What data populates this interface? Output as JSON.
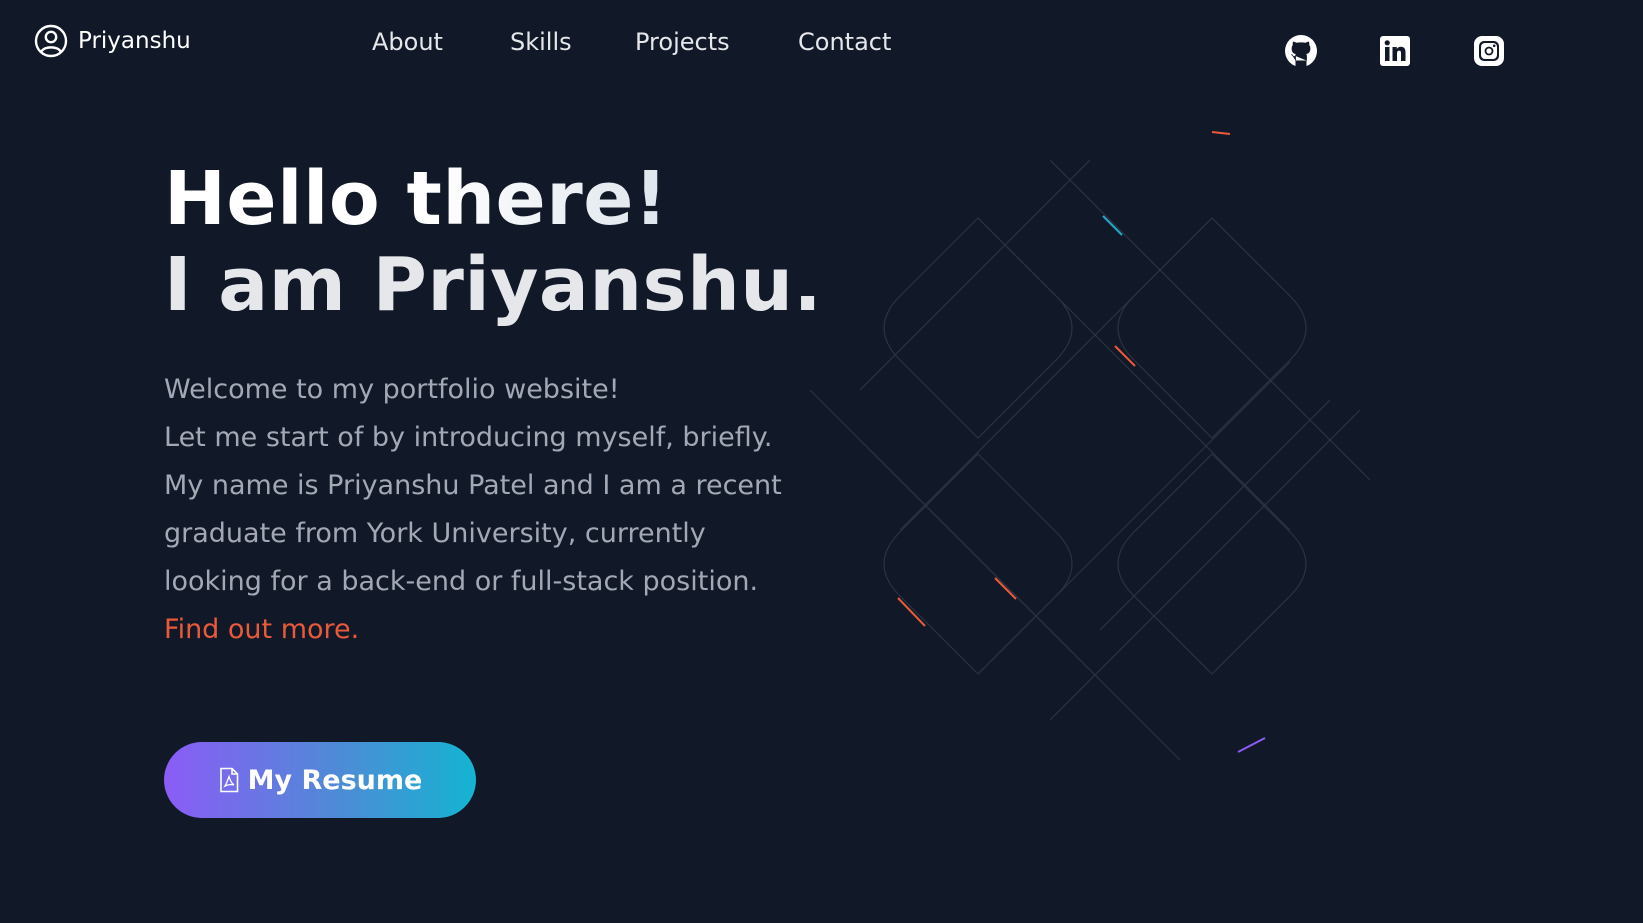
{
  "header": {
    "brand_name": "Priyanshu",
    "brand_icon": "user-circle-icon"
  },
  "nav": {
    "items": [
      {
        "label": "About"
      },
      {
        "label": "Skills"
      },
      {
        "label": "Projects"
      },
      {
        "label": "Contact"
      }
    ]
  },
  "social": {
    "github_icon": "github-icon",
    "linkedin_icon": "linkedin-icon",
    "instagram_icon": "instagram-icon"
  },
  "hero": {
    "title_line1": "Hello there!",
    "title_line2": "I am Priyanshu.",
    "intro_line1": "Welcome to my portfolio website!",
    "intro_line2": "Let me start of by introducing myself, briefly.",
    "intro_line3": "My name is Priyanshu Patel and I am a recent graduate from York University, currently looking for a back-end or full-stack position.",
    "find_more": "Find out more.",
    "resume_label": "My Resume",
    "resume_icon": "pdf-file-icon"
  },
  "colors": {
    "background": "#111827",
    "accent": "#ea5a3a",
    "button_gradient_start": "#8b5cf6",
    "button_gradient_end": "#14b4d2",
    "body_text": "#a3a8b4"
  }
}
